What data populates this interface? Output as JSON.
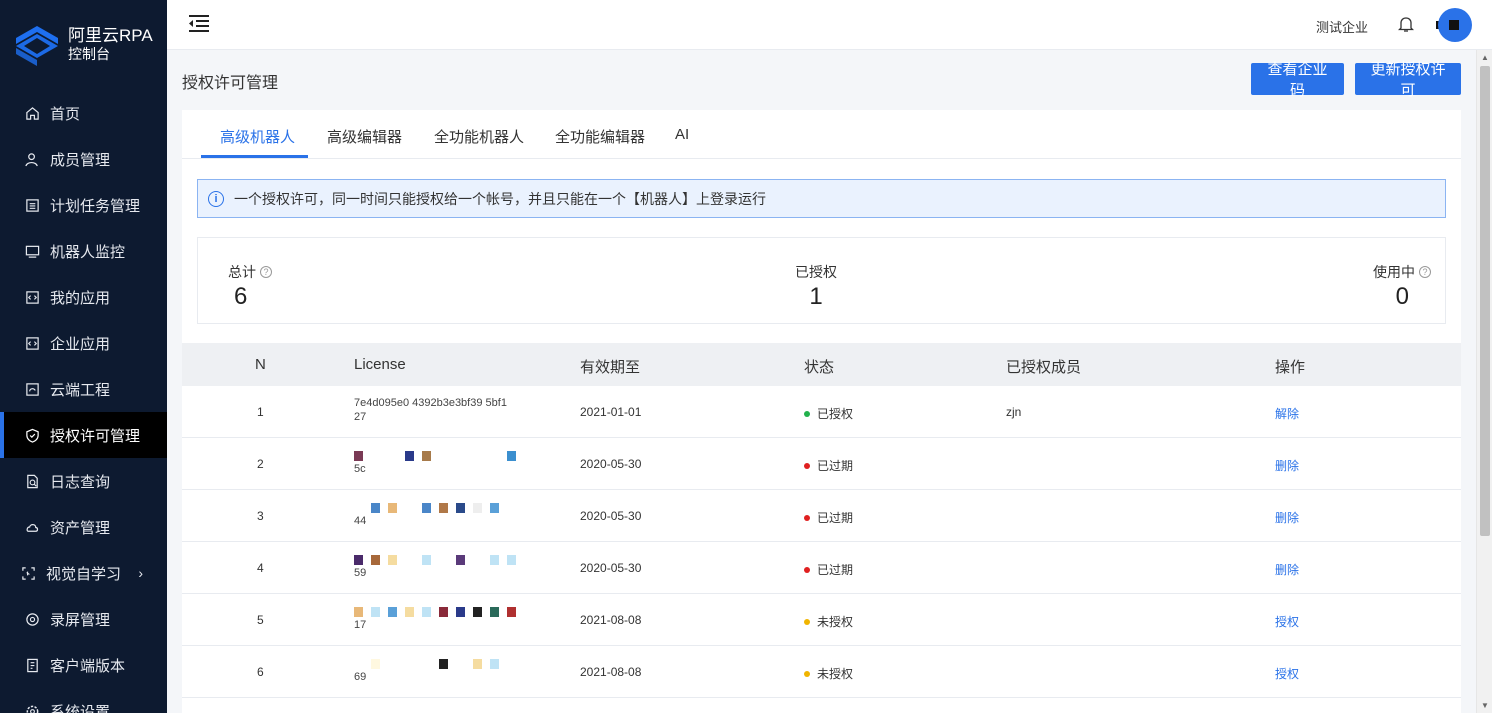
{
  "brand": {
    "title": "阿里云RPA",
    "subtitle": "控制台"
  },
  "sidebar": {
    "items": [
      {
        "label": "首页",
        "icon": "home-icon"
      },
      {
        "label": "成员管理",
        "icon": "user-icon"
      },
      {
        "label": "计划任务管理",
        "icon": "list-icon"
      },
      {
        "label": "机器人监控",
        "icon": "monitor-icon"
      },
      {
        "label": "我的应用",
        "icon": "app-icon"
      },
      {
        "label": "企业应用",
        "icon": "app-icon"
      },
      {
        "label": "云端工程",
        "icon": "cloud-project-icon"
      },
      {
        "label": "授权许可管理",
        "icon": "shield-icon",
        "active": true
      },
      {
        "label": "日志查询",
        "icon": "log-icon"
      },
      {
        "label": "资产管理",
        "icon": "cloud-icon"
      },
      {
        "label": "视觉自学习",
        "icon": "scan-icon",
        "has_children": true
      },
      {
        "label": "录屏管理",
        "icon": "record-icon"
      },
      {
        "label": "客户端版本",
        "icon": "client-icon"
      },
      {
        "label": "系统设置",
        "icon": "settings-icon"
      }
    ],
    "chevron": "›"
  },
  "header": {
    "company": "测试企业"
  },
  "page": {
    "title": "授权许可管理",
    "btn_code": "查看企业码",
    "btn_update": "更新授权许可"
  },
  "tabs": [
    {
      "label": "高级机器人",
      "active": true
    },
    {
      "label": "高级编辑器"
    },
    {
      "label": "全功能机器人"
    },
    {
      "label": "全功能编辑器"
    },
    {
      "label": "AI"
    }
  ],
  "notice": {
    "icon": "i",
    "text": "一个授权许可，同一时间只能授权给一个帐号，并且只能在一个【机器人】上登录运行"
  },
  "stats": {
    "total": {
      "label": "总计",
      "value": "6"
    },
    "authorized": {
      "label": "已授权",
      "value": "1"
    },
    "in_use": {
      "label": "使用中",
      "value": "0"
    }
  },
  "table": {
    "columns": [
      "N",
      "License",
      "有效期至",
      "状态",
      "已授权成员",
      "操作"
    ],
    "rows": [
      {
        "n": "1",
        "license_head": "7e4d095e0  4392b3e3bf39  5bf1",
        "license_tail": "27",
        "date": "2021-01-01",
        "status": "已授权",
        "status_color": "#22b14c",
        "member": "zjn",
        "op": "解除"
      },
      {
        "n": "2",
        "license_head": "",
        "license_tail": "5c",
        "date": "2020-05-30",
        "status": "已过期",
        "status_color": "#e02020",
        "member": "",
        "op": "删除"
      },
      {
        "n": "3",
        "license_head": "",
        "license_tail": "44",
        "date": "2020-05-30",
        "status": "已过期",
        "status_color": "#e02020",
        "member": "",
        "op": "删除"
      },
      {
        "n": "4",
        "license_head": "",
        "license_tail": "59",
        "date": "2020-05-30",
        "status": "已过期",
        "status_color": "#e02020",
        "member": "",
        "op": "删除"
      },
      {
        "n": "5",
        "license_head": "",
        "license_tail": "17",
        "date": "2021-08-08",
        "status": "未授权",
        "status_color": "#f0b400",
        "member": "",
        "op": "授权"
      },
      {
        "n": "6",
        "license_head": "",
        "license_tail": "69",
        "date": "2021-08-08",
        "status": "未授权",
        "status_color": "#f0b400",
        "member": "",
        "op": "授权"
      }
    ]
  },
  "colors": {
    "accent": "#2a72e8",
    "sidebar_bg": "#0d1a30"
  }
}
